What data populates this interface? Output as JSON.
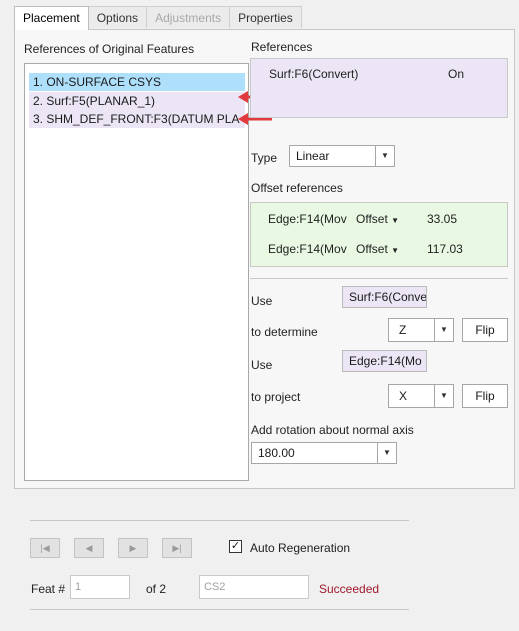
{
  "tabs": [
    {
      "label": "Placement",
      "state": "active"
    },
    {
      "label": "Options",
      "state": "normal"
    },
    {
      "label": "Adjustments",
      "state": "disabled"
    },
    {
      "label": "Properties",
      "state": "normal"
    }
  ],
  "left": {
    "heading": "References of Original Features",
    "items": [
      "1. ON-SURFACE CSYS",
      "2. Surf:F5(PLANAR_1)",
      "3. SHM_DEF_FRONT:F3(DATUM PLA"
    ]
  },
  "references": {
    "heading": "References",
    "item": "Surf:F6(Convert)",
    "status": "On"
  },
  "type": {
    "label": "Type",
    "value": "Linear"
  },
  "offset": {
    "heading": "Offset references",
    "rows": [
      {
        "ref": "Edge:F14(Mov",
        "kind": "Offset",
        "value": "33.05"
      },
      {
        "ref": "Edge:F14(Mov",
        "kind": "Offset",
        "value": "117.03"
      }
    ]
  },
  "orient": {
    "use1": "Use",
    "use1_value": "Surf:F6(Conve",
    "determine": "to determine",
    "determine_axis": "Z",
    "flip": "Flip",
    "use2": "Use",
    "use2_value": "Edge:F14(Mo",
    "project": "to project",
    "project_axis": "X"
  },
  "rotation": {
    "label": "Add rotation about normal axis",
    "value": "180.00"
  },
  "footer": {
    "auto_regen": "Auto Regeneration",
    "auto_regen_checked": true,
    "feat_label": "Feat #",
    "feat_value": "1",
    "of_label": "of 2",
    "name_value": "CS2",
    "status": "Succeeded",
    "status_color": "#a0182c"
  },
  "annotation_color": "#e0393e"
}
